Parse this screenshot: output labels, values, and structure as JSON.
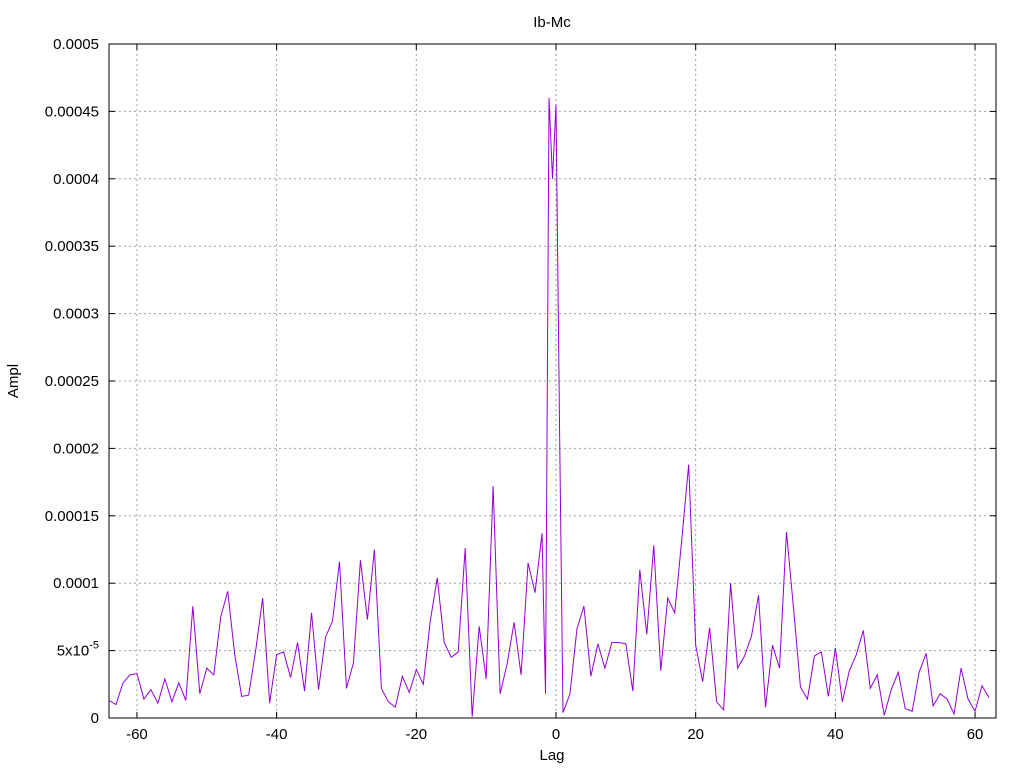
{
  "chart_data": {
    "type": "line",
    "title": "Ib-Mc",
    "xlabel": "Lag",
    "ylabel": "Ampl",
    "xlim": [
      -64,
      63
    ],
    "ylim": [
      0,
      0.0005
    ],
    "grid": true,
    "x_ticks": [
      -60,
      -40,
      -20,
      0,
      20,
      40,
      60
    ],
    "x_tick_labels": [
      "-60",
      "-40",
      "-20",
      "0",
      "20",
      "40",
      "60"
    ],
    "y_ticks": [
      0,
      5e-05,
      0.0001,
      0.00015,
      0.0002,
      0.00025,
      0.0003,
      0.00035,
      0.0004,
      0.00045,
      0.0005
    ],
    "y_tick_labels": [
      "0",
      "5x10-5",
      "0.0001",
      "0.00015",
      "0.0002",
      "0.00025",
      "0.0003",
      "0.00035",
      "0.0004",
      "0.00045",
      "0.0005"
    ],
    "series": [
      {
        "color": "#9400d3",
        "points": [
          [
            -64,
            1.3e-05
          ],
          [
            -63,
            1e-05
          ],
          [
            -62,
            2.6e-05
          ],
          [
            -61,
            3.2e-05
          ],
          [
            -60,
            3.3e-05
          ],
          [
            -59,
            1.4e-05
          ],
          [
            -58,
            2.1e-05
          ],
          [
            -57,
            1.1e-05
          ],
          [
            -56,
            2.9e-05
          ],
          [
            -55,
            1.2e-05
          ],
          [
            -54,
            2.6e-05
          ],
          [
            -53,
            1.3e-05
          ],
          [
            -52,
            8.3e-05
          ],
          [
            -51,
            1.8e-05
          ],
          [
            -50,
            3.7e-05
          ],
          [
            -49,
            3.2e-05
          ],
          [
            -48,
            7.5e-05
          ],
          [
            -47,
            9.4e-05
          ],
          [
            -46,
            4.7e-05
          ],
          [
            -45,
            1.6e-05
          ],
          [
            -44,
            1.7e-05
          ],
          [
            -43,
            5e-05
          ],
          [
            -42,
            8.9e-05
          ],
          [
            -41,
            1.1e-05
          ],
          [
            -40,
            4.7e-05
          ],
          [
            -39,
            4.9e-05
          ],
          [
            -38,
            3e-05
          ],
          [
            -37,
            5.6e-05
          ],
          [
            -36,
            2e-05
          ],
          [
            -35,
            7.8e-05
          ],
          [
            -34,
            2.1e-05
          ],
          [
            -33,
            6e-05
          ],
          [
            -32,
            7.2e-05
          ],
          [
            -31,
            0.000116
          ],
          [
            -30,
            2.2e-05
          ],
          [
            -29,
            4.1e-05
          ],
          [
            -28,
            0.000117
          ],
          [
            -27,
            7.3e-05
          ],
          [
            -26,
            0.000125
          ],
          [
            -25,
            2.2e-05
          ],
          [
            -24,
            1.2e-05
          ],
          [
            -23,
            8e-06
          ],
          [
            -22,
            3.1e-05
          ],
          [
            -21,
            1.9e-05
          ],
          [
            -20,
            3.6e-05
          ],
          [
            -19,
            2.5e-05
          ],
          [
            -18,
            7.2e-05
          ],
          [
            -17,
            0.000104
          ],
          [
            -16,
            5.6e-05
          ],
          [
            -15,
            4.5e-05
          ],
          [
            -14,
            4.9e-05
          ],
          [
            -13,
            0.000126
          ],
          [
            -12,
            1e-06
          ],
          [
            -11,
            6.8e-05
          ],
          [
            -10,
            2.9e-05
          ],
          [
            -9,
            0.000172
          ],
          [
            -8,
            1.8e-05
          ],
          [
            -7,
            4e-05
          ],
          [
            -6,
            7.1e-05
          ],
          [
            -5,
            3.2e-05
          ],
          [
            -4,
            0.000115
          ],
          [
            -3,
            9.3e-05
          ],
          [
            -2,
            0.000137
          ],
          [
            -1.5,
            1.8e-05
          ],
          [
            -1,
            0.00046
          ],
          [
            -0.5,
            0.0004
          ],
          [
            0,
            0.000455
          ],
          [
            0.5,
            0.00022
          ],
          [
            1,
            4e-06
          ],
          [
            2,
            1.8e-05
          ],
          [
            3,
            6.6e-05
          ],
          [
            4,
            8.3e-05
          ],
          [
            5,
            3.1e-05
          ],
          [
            6,
            5.5e-05
          ],
          [
            7,
            3.7e-05
          ],
          [
            8,
            5.6e-05
          ],
          [
            9,
            5.6e-05
          ],
          [
            10,
            5.5e-05
          ],
          [
            11,
            2e-05
          ],
          [
            12,
            0.00011
          ],
          [
            13,
            6.2e-05
          ],
          [
            14,
            0.000128
          ],
          [
            15,
            3.5e-05
          ],
          [
            16,
            8.9e-05
          ],
          [
            17,
            7.8e-05
          ],
          [
            18,
            0.000132
          ],
          [
            19,
            0.000188
          ],
          [
            20,
            5.4e-05
          ],
          [
            21,
            2.7e-05
          ],
          [
            22,
            6.7e-05
          ],
          [
            23,
            1.2e-05
          ],
          [
            24,
            6e-06
          ],
          [
            25,
            0.0001
          ],
          [
            26,
            3.7e-05
          ],
          [
            27,
            4.6e-05
          ],
          [
            28,
            6.1e-05
          ],
          [
            29,
            9.1e-05
          ],
          [
            30,
            8e-06
          ],
          [
            31,
            5.4e-05
          ],
          [
            32,
            3.7e-05
          ],
          [
            33,
            0.000138
          ],
          [
            34,
            8.2e-05
          ],
          [
            35,
            2.3e-05
          ],
          [
            36,
            1.4e-05
          ],
          [
            37,
            4.6e-05
          ],
          [
            38,
            4.9e-05
          ],
          [
            39,
            1.6e-05
          ],
          [
            40,
            5.2e-05
          ],
          [
            41,
            1.2e-05
          ],
          [
            42,
            3.5e-05
          ],
          [
            43,
            4.7e-05
          ],
          [
            44,
            6.5e-05
          ],
          [
            45,
            2.2e-05
          ],
          [
            46,
            3.2e-05
          ],
          [
            47,
            2e-06
          ],
          [
            48,
            2.1e-05
          ],
          [
            49,
            3.4e-05
          ],
          [
            50,
            7e-06
          ],
          [
            51,
            5e-06
          ],
          [
            52,
            3.4e-05
          ],
          [
            53,
            4.8e-05
          ],
          [
            54,
            9e-06
          ],
          [
            55,
            1.8e-05
          ],
          [
            56,
            1.4e-05
          ],
          [
            57,
            3e-06
          ],
          [
            58,
            3.7e-05
          ],
          [
            59,
            1.4e-05
          ],
          [
            60,
            5e-06
          ],
          [
            61,
            2.4e-05
          ],
          [
            62,
            1.5e-05
          ]
        ]
      }
    ]
  }
}
